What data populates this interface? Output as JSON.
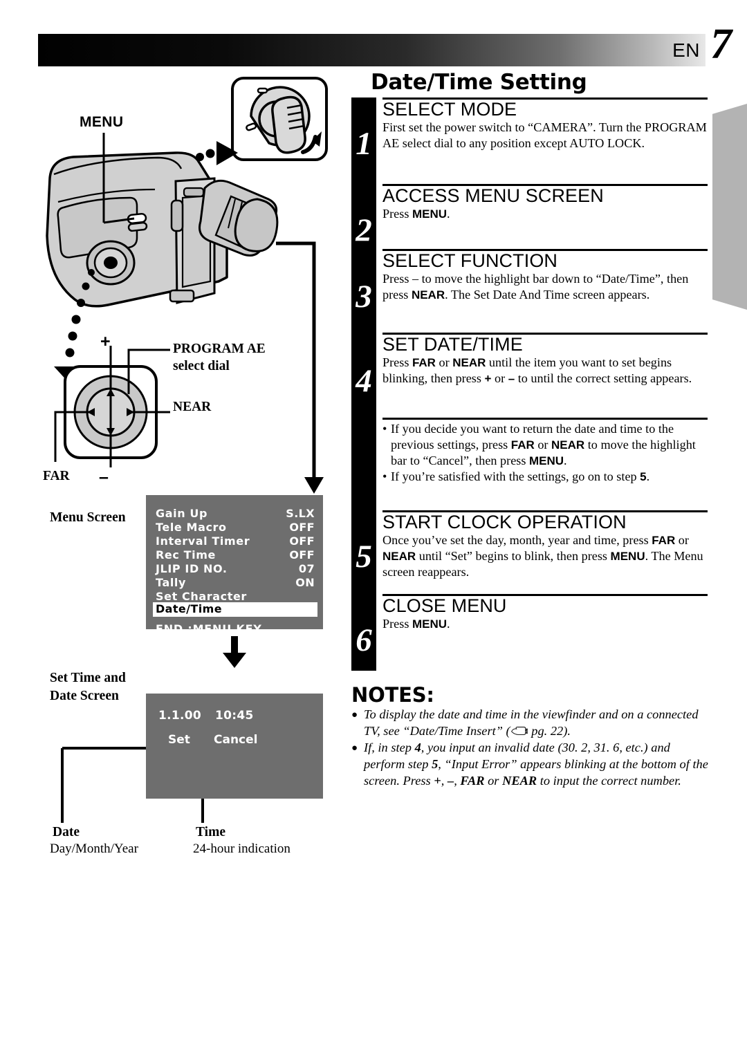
{
  "header": {
    "lang_code": "EN",
    "page_number": "7"
  },
  "title": "Date/Time Setting",
  "steps": [
    {
      "number": "1",
      "heading": "SELECT MODE",
      "body": "First set the power switch to “CAMERA”. Turn the PROGRAM AE select dial to any position except AUTO LOCK."
    },
    {
      "number": "2",
      "heading": "ACCESS MENU SCREEN",
      "body": "Press MENU."
    },
    {
      "number": "3",
      "heading": "SELECT FUNCTION",
      "body": "Press – to move the highlight bar down to “Date/Time”, then press NEAR. The Set Date And Time screen appears."
    },
    {
      "number": "4",
      "heading": "SET DATE/TIME",
      "body": "Press FAR or NEAR until the item you want to set begins blinking, then press + or – to until the correct setting appears."
    },
    {
      "number": "5",
      "heading": "START CLOCK OPERATION",
      "body": "Once you’ve set the day, month, year and time, press FAR or NEAR until “Set” begins to blink, then press MENU. The Menu screen reappears."
    },
    {
      "number": "6",
      "heading": "CLOSE MENU",
      "body": "Press MENU."
    }
  ],
  "step4_bullets": [
    "If you decide you want to return the date and time to the previous settings, press FAR or NEAR to move the highlight bar to “Cancel”, then press MENU.",
    "If you’re satisfied with the settings, go on to step 5."
  ],
  "notes": {
    "title": "NOTES:",
    "items": [
      "To display the date and time in the viewfinder and on a connected TV, see “Date/Time Insert” (☞ pg. 22).",
      "If, in step 4, you input an invalid date (30. 2, 31. 6, etc.) and perform step 5, “Input Error” appears blinking at the bottom of the screen. Press +, –, FAR or NEAR to input the correct number."
    ]
  },
  "callouts": {
    "menu": "MENU",
    "program_ae_line1": "PROGRAM AE",
    "program_ae_line2": "select dial",
    "near": "NEAR",
    "far": "FAR",
    "plus": "+",
    "minus": "–",
    "menu_screen": "Menu Screen",
    "set_time_and_date_line1": "Set Time and",
    "set_time_and_date_line2": "Date Screen"
  },
  "menu_screen": {
    "rows": [
      {
        "label": "Gain Up",
        "value": "S.LX"
      },
      {
        "label": "Tele Macro",
        "value": "OFF"
      },
      {
        "label": "Interval Timer",
        "value": "OFF"
      },
      {
        "label": "Rec Time",
        "value": "OFF"
      },
      {
        "label": "JLIP ID NO.",
        "value": "07"
      },
      {
        "label": "Tally",
        "value": "ON"
      },
      {
        "label": "Set Character",
        "value": ""
      }
    ],
    "highlighted": "Date/Time",
    "footer": "END :MENU KEY"
  },
  "set_time_screen": {
    "date_value": "1.1.00",
    "time_value": "10:45",
    "set_button": "Set",
    "cancel_button": "Cancel"
  },
  "bottom_labels": {
    "date_title": "Date",
    "date_sub": "Day/Month/Year",
    "time_title": "Time",
    "time_sub": "24-hour indication"
  },
  "colors": {
    "osd_gray": "#6e6e6e",
    "tab_gray": "#b3b3b3",
    "ink": "#000000"
  }
}
